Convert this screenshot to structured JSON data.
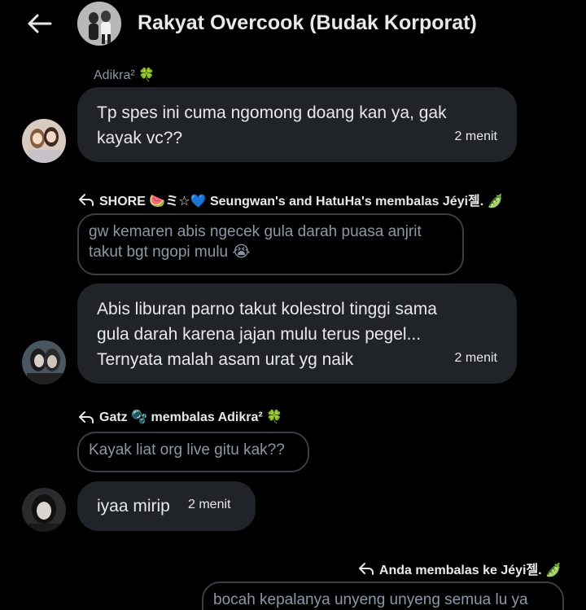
{
  "header": {
    "title": "Rakyat Overcook (Budak Korporat)"
  },
  "messages": [
    {
      "sender": "Adikra² 🍀",
      "text": "Tp spes ini cuma ngomong doang kan ya, gak\nkayak vc??",
      "time": "2 menit"
    },
    {
      "reply_header": "SHORE 🍉ミ☆💙 Seungwan's and HatuHa's membalas Jéyi젤. 🫛",
      "quote": "gw kemaren abis ngecek gula darah puasa anjrit\ntakut bgt ngopi mulu 😭",
      "text": "Abis liburan parno takut kolestrol tinggi sama\ngula darah karena jajan mulu terus pegel...\nTernyata malah asam urat yg naik",
      "time": "2 menit"
    },
    {
      "reply_header": "Gatz 🫧 membalas Adikra² 🍀",
      "quote": "Kayak liat org live gitu kak??",
      "text": "iyaa mirip",
      "time": "2 menit"
    },
    {
      "reply_header": "Anda membalas ke Jéyi젤. 🫛",
      "quote": "bocah kepalanya unyeng unyeng semua lu ya"
    }
  ]
}
